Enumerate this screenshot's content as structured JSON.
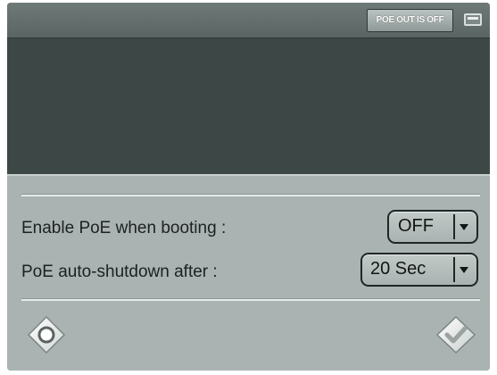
{
  "status_bar": {
    "poe_status": "POE OUT IS OFF",
    "battery_icon": "battery-icon"
  },
  "settings": [
    {
      "label": "Enable PoE when booting :",
      "value": "OFF"
    },
    {
      "label": "PoE auto-shutdown after :",
      "value": "20 Sec"
    }
  ],
  "footer": {
    "nav_icon": "navigation-pad-icon",
    "confirm_icon": "checkmark-icon"
  },
  "colors": {
    "screen_bg": "#3f4a48",
    "panel_bg": "#aab3b1",
    "badge_text": "#ffffff"
  }
}
